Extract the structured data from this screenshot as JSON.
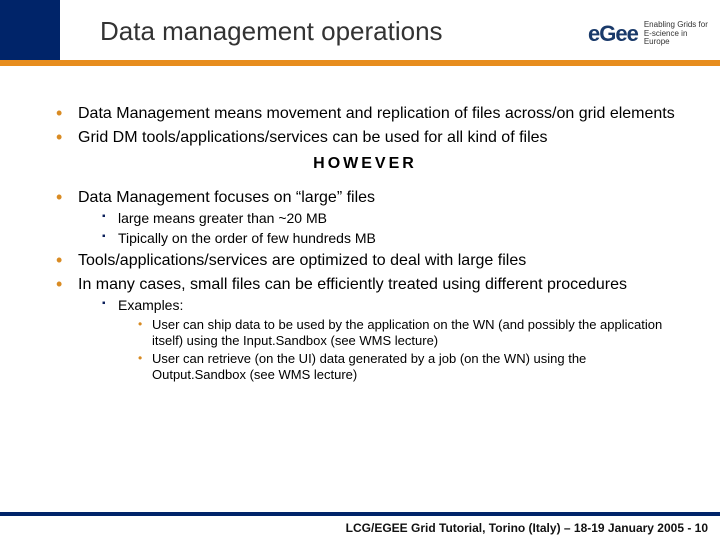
{
  "header": {
    "title": "Data management operations",
    "logo": {
      "mark": "eGee",
      "tag": "Enabling Grids for\nE-science in Europe"
    }
  },
  "content": {
    "block1": [
      "Data Management means movement and replication of files across/on grid elements",
      "Grid DM tools/applications/services can be used for all kind of files"
    ],
    "however": "HOWEVER",
    "block2_item": "Data Management focuses on “large” files",
    "block2_sub": [
      "large means greater than ~20 MB",
      "Tipically on the order of few hundreds MB"
    ],
    "block3": [
      "Tools/applications/services are optimized to deal with large files",
      "In many cases, small files can be efficiently treated using different procedures"
    ],
    "examples_label": "Examples:",
    "examples": [
      "User can ship data to be used by the application on the WN (and possibly the application itself) using the Input.Sandbox (see WMS lecture)",
      "User can retrieve (on the UI) data generated by a job (on the WN) using the Output.Sandbox (see WMS lecture)"
    ]
  },
  "footer": {
    "text": "LCG/EGEE Grid Tutorial, Torino (Italy) – 18-19 January 2005 - 10"
  }
}
